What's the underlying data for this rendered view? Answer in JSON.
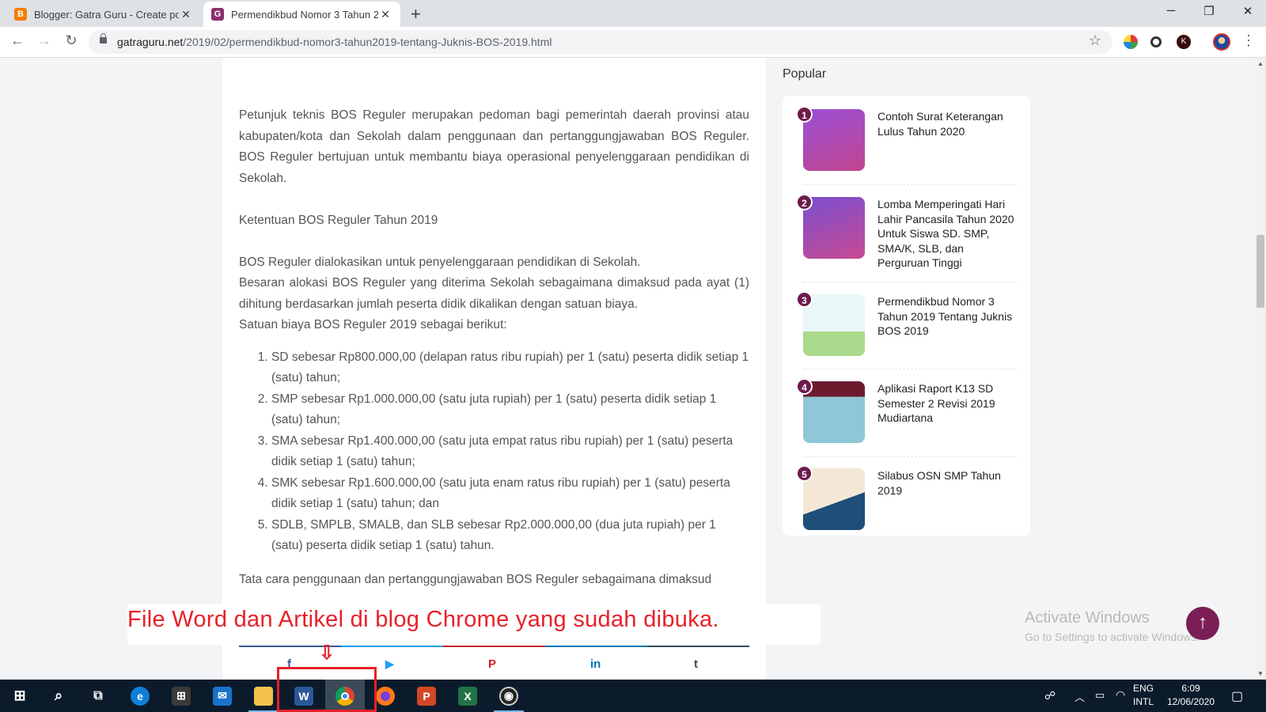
{
  "browser": {
    "tabs": [
      {
        "title": "Blogger: Gatra Guru - Create pos",
        "icon": "blogger-icon",
        "color": "#f57d00"
      },
      {
        "title": "Permendikbud Nomor 3 Tahun 20",
        "icon": "gatraguru-icon",
        "color": "#8e2d6b"
      }
    ],
    "new_tab": "+",
    "url_domain": "gatraguru.net",
    "url_path": "/2019/02/permendikbud-nomor3-tahun2019-tentang-Juknis-BOS-2019.html",
    "window_controls": {
      "minimize": "─",
      "restore": "❐",
      "close": "✕"
    }
  },
  "article": {
    "para1": "Petunjuk teknis BOS Reguler merupakan pedoman bagi pemerintah daerah provinsi atau kabupaten/kota dan Sekolah dalam penggunaan dan pertanggungjawaban BOS Reguler. BOS Reguler bertujuan untuk membantu biaya operasional penyelenggaraan pendidikan di Sekolah.",
    "heading": "Ketentuan BOS Reguler Tahun 2019",
    "para2": "BOS Reguler dialokasikan untuk penyelenggaraan pendidikan di Sekolah.",
    "para3": "Besaran alokasi BOS Reguler yang diterima Sekolah sebagaimana dimaksud pada ayat (1) dihitung berdasarkan jumlah peserta didik dikalikan dengan satuan biaya.",
    "para4": "Satuan biaya BOS Reguler 2019 sebagai berikut:",
    "list": [
      "SD sebesar Rp800.000,00 (delapan ratus ribu rupiah) per 1 (satu) peserta didik setiap 1 (satu) tahun;",
      "SMP sebesar Rp1.000.000,00 (satu juta rupiah) per 1 (satu) peserta didik setiap 1 (satu) tahun;",
      "SMA sebesar Rp1.400.000,00 (satu juta empat ratus ribu rupiah) per 1 (satu) peserta didik setiap 1 (satu) tahun;",
      "SMK sebesar Rp1.600.000,00 (satu juta enam ratus ribu rupiah) per 1 (satu) peserta didik setiap 1 (satu) tahun; dan",
      "SDLB, SMPLB, SMALB, dan SLB sebesar Rp2.000.000,00 (dua juta rupiah) per 1 (satu) peserta didik setiap 1 (satu) tahun."
    ],
    "para5": "Tata cara penggunaan dan pertanggungjawaban BOS Reguler sebagaimana dimaksud",
    "share": [
      {
        "icon": "facebook-icon",
        "glyph": "f",
        "color": "#3b5998"
      },
      {
        "icon": "twitter-icon",
        "glyph": "🐦",
        "color": "#1da1f2"
      },
      {
        "icon": "pinterest-icon",
        "glyph": "P",
        "color": "#cb2027"
      },
      {
        "icon": "linkedin-icon",
        "glyph": "in",
        "color": "#0077b5"
      },
      {
        "icon": "tumblr-icon",
        "glyph": "t",
        "color": "#35465c"
      }
    ]
  },
  "sidebar": {
    "title": "Popular",
    "items": [
      {
        "rank": "1",
        "title": "Contoh Surat Keterangan Lulus Tahun 2020"
      },
      {
        "rank": "2",
        "title": "Lomba Memperingati Hari Lahir Pancasila Tahun 2020 Untuk Siswa SD. SMP, SMA/K, SLB, dan Perguruan Tinggi"
      },
      {
        "rank": "3",
        "title": "Permendikbud Nomor 3 Tahun 2019 Tentang Juknis BOS 2019"
      },
      {
        "rank": "4",
        "title": "Aplikasi Raport K13 SD Semester 2 Revisi 2019 Mudiartana"
      },
      {
        "rank": "5",
        "title": "Silabus OSN SMP Tahun 2019"
      }
    ]
  },
  "windows": {
    "activate_title": "Activate Windows",
    "activate_sub": "Go to Settings to activate Windows.",
    "lang_line1": "ENG",
    "lang_line2": "INTL",
    "time": "6:09",
    "date": "12/06/2020"
  },
  "annotation": {
    "text": "File Word dan Artikel di blog Chrome yang sudah dibuka.",
    "arrow": "⇩"
  },
  "colors": {
    "accent": "#7a1e55",
    "annotation": "#e8202a",
    "taskbar": "#0b1b2b"
  }
}
